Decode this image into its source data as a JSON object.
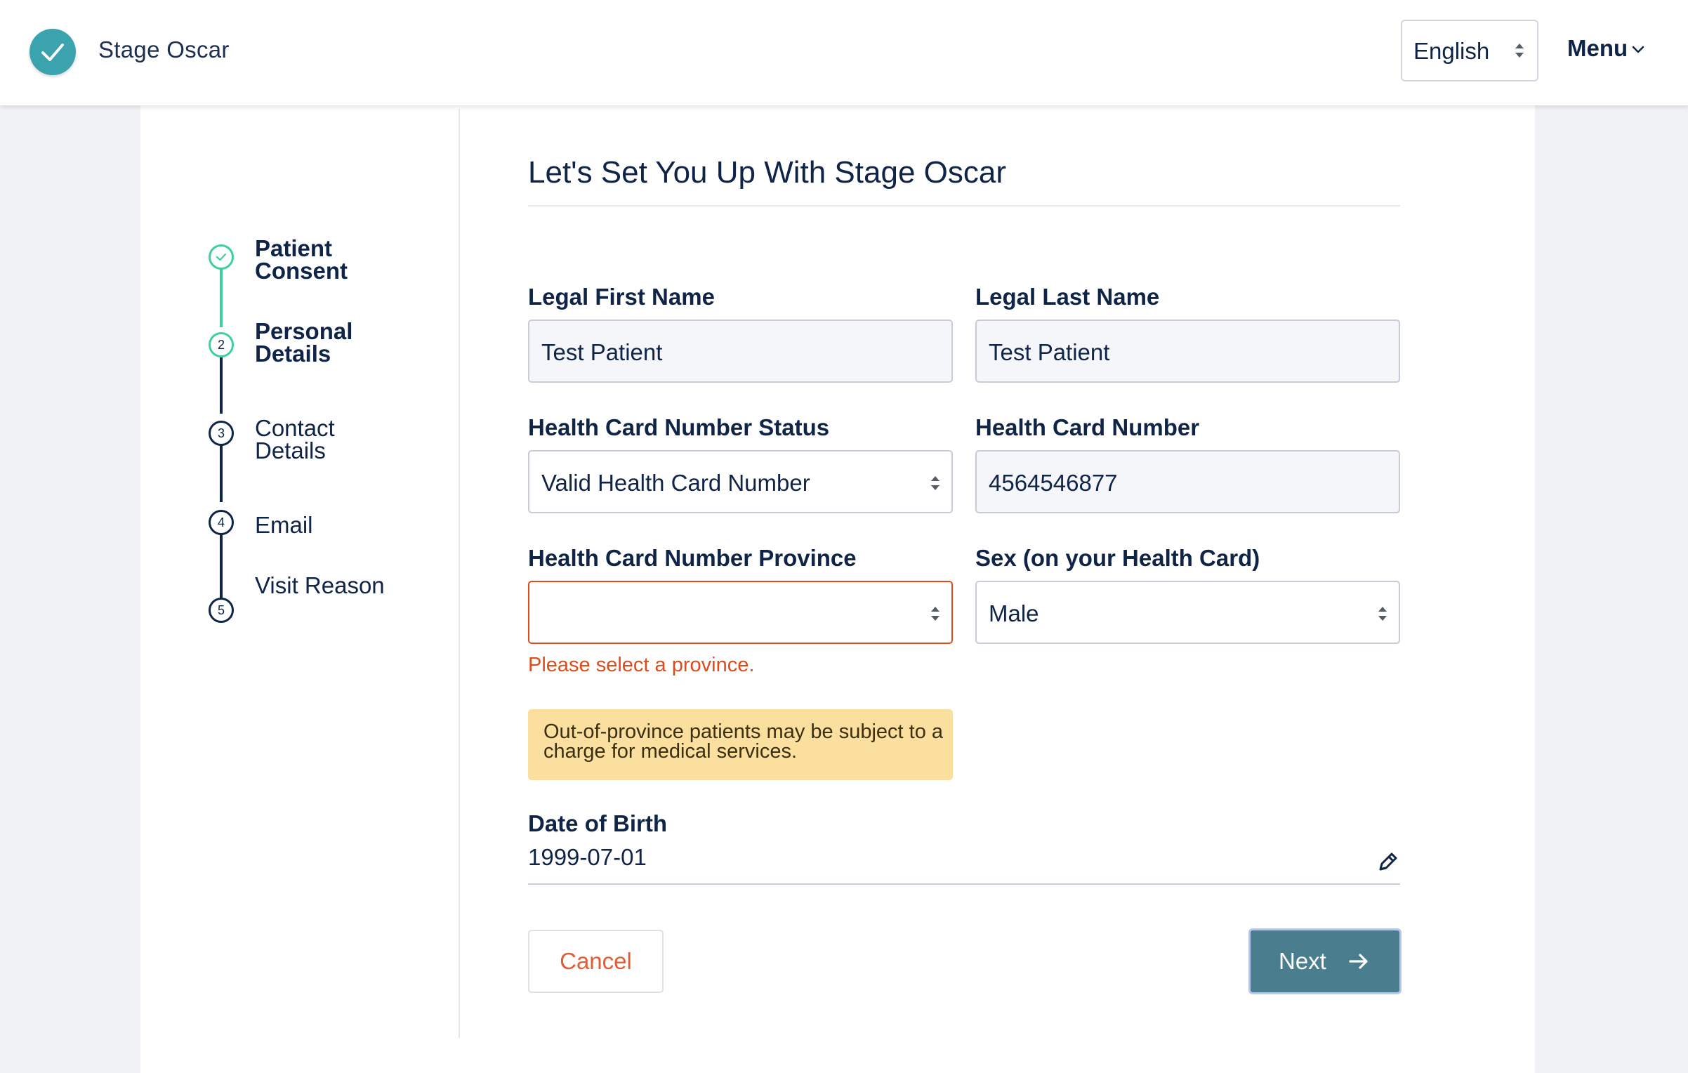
{
  "header": {
    "app_name": "Stage Oscar",
    "language": "English",
    "menu_label": "Menu"
  },
  "stepper": {
    "steps": [
      {
        "number": "",
        "label_line1": "Patient",
        "label_line2": "Consent",
        "state": "completed"
      },
      {
        "number": "2",
        "label_line1": "Personal",
        "label_line2": "Details",
        "state": "active"
      },
      {
        "number": "3",
        "label_line1": "Contact",
        "label_line2": "Details",
        "state": "pending"
      },
      {
        "number": "4",
        "label_line1": "Email",
        "label_line2": "",
        "state": "pending"
      },
      {
        "number": "5",
        "label_line1": "Visit Reason",
        "label_line2": "",
        "state": "pending"
      }
    ]
  },
  "form": {
    "title": "Let's Set You Up With Stage Oscar",
    "first_name": {
      "label": "Legal First Name",
      "value": "Test Patient"
    },
    "last_name": {
      "label": "Legal Last Name",
      "value": "Test Patient"
    },
    "hc_status": {
      "label": "Health Card Number Status",
      "value": "Valid Health Card Number"
    },
    "hc_number": {
      "label": "Health Card Number",
      "value": "4564546877"
    },
    "hc_province": {
      "label": "Health Card Number Province",
      "value": "",
      "error": "Please select a province."
    },
    "sex": {
      "label": "Sex (on your Health Card)",
      "value": "Male"
    },
    "notice": "Out-of-province patients may be subject to a charge for medical services.",
    "dob": {
      "label": "Date of Birth",
      "value": "1999-07-01"
    },
    "cancel_label": "Cancel",
    "next_label": "Next"
  },
  "colors": {
    "accent_teal": "#3aa3ad",
    "step_green": "#3ccf9f",
    "error": "#e04b1a",
    "primary_button": "#4a7d8d",
    "notice_bg": "#fadf9f"
  }
}
